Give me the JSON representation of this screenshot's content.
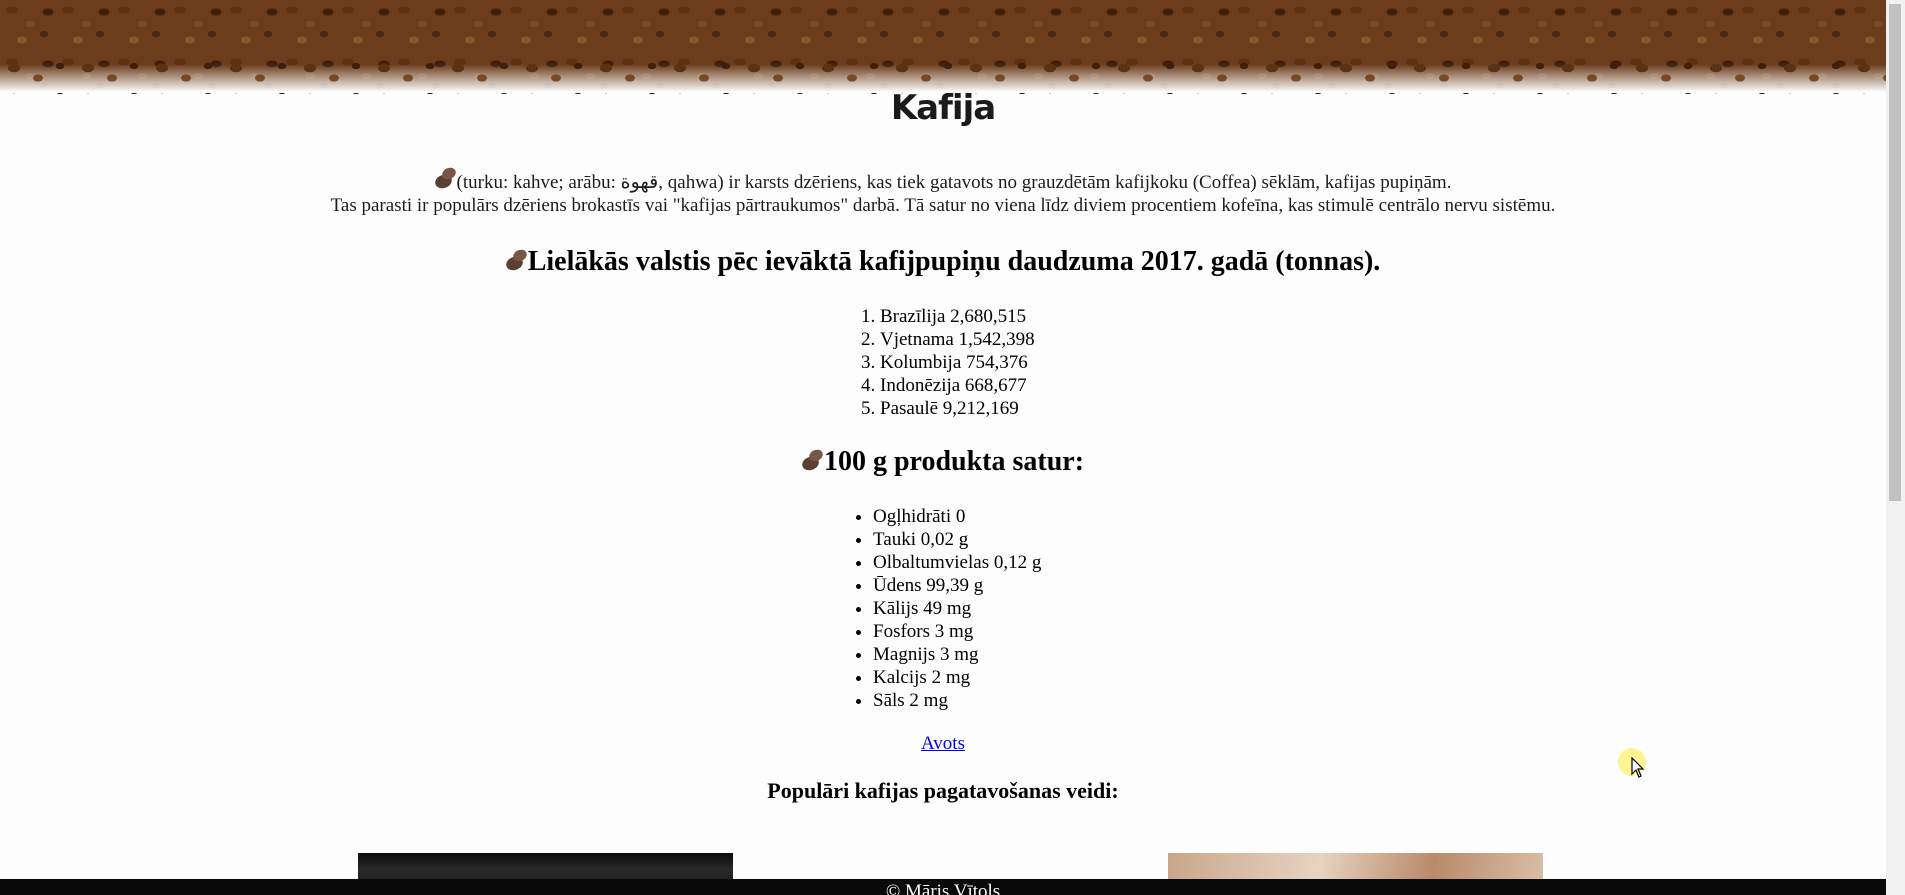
{
  "page": {
    "title": "Kafija",
    "intro_line1": "(turku: kahve; arābu: قهوة, qahwa) ir karsts dzēriens, kas tiek gatavots no grauzdētām kafijkoku (Coffea) sēklām, kafijas pupiņām.",
    "intro_line2": "Tas parasti ir populārs dzēriens brokastīs vai \"kafijas pārtraukumos\" darbā. Tā satur no viena līdz diviem procentiem kofeīna, kas stimulē centrālo nervu sistēmu."
  },
  "countries": {
    "heading": "Lielākās valstis pēc ievāktā kafijpupiņu daudzuma 2017. gadā (tonnas).",
    "items": [
      "Brazīlija 2,680,515",
      "Vjetnama 1,542,398",
      "Kolumbija 754,376",
      "Indonēzija 668,677",
      "Pasaulē 9,212,169"
    ]
  },
  "nutrition": {
    "heading": "100 g produkta satur:",
    "items": [
      "Ogļhidrāti 0",
      "Tauki 0,02 g",
      "Olbaltumvielas 0,12 g",
      "Ūdens 99,39 g",
      "Kālijs 49 mg",
      "Fosfors 3 mg",
      "Magnijs 3 mg",
      "Kalcijs 2 mg",
      "Sāls 2 mg"
    ]
  },
  "source_link": "Avots",
  "ways_heading": "Populāri kafijas pagatavošanas veidi:",
  "footer": "© Māris Vītols",
  "icons": {
    "bean": "coffee-bean-icon"
  }
}
